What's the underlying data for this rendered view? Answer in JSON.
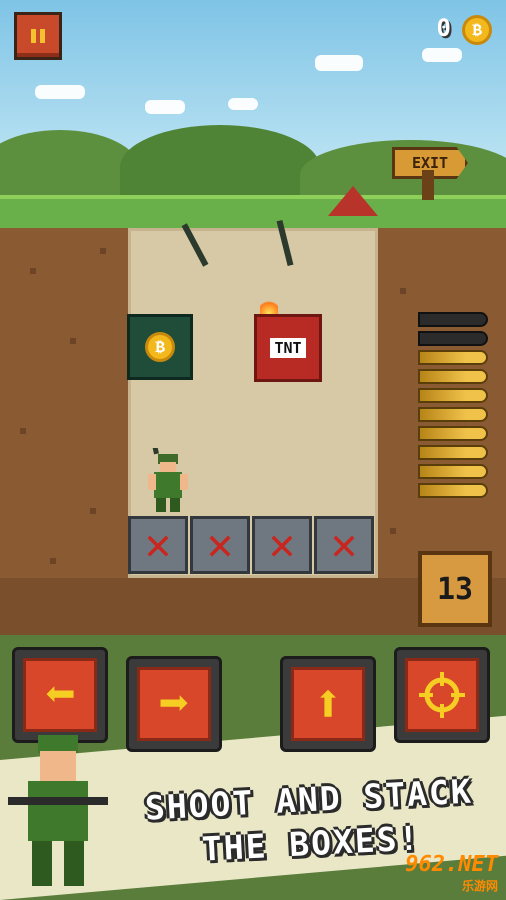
{
  "hud": {
    "coin_count": "0",
    "coin_symbol": "₿"
  },
  "scenery": {
    "exit_sign": "EXIT"
  },
  "field": {
    "tnt_label": "TNT",
    "coin_box_symbol": "₿",
    "crate_mark": "✕"
  },
  "ammo": {
    "remaining": "13",
    "bullets_loaded": 8,
    "bullets_spent": 2
  },
  "controls": {
    "left_icon": "arrow-left-icon",
    "right_icon": "arrow-right-icon",
    "up_icon": "arrow-up-icon",
    "fire_icon": "crosshair-icon"
  },
  "tagline": {
    "line1": "SHOOT AND STACK",
    "line2": "THE BOXES!"
  },
  "watermark": {
    "brand": "962.NET",
    "sub": "乐游网"
  }
}
